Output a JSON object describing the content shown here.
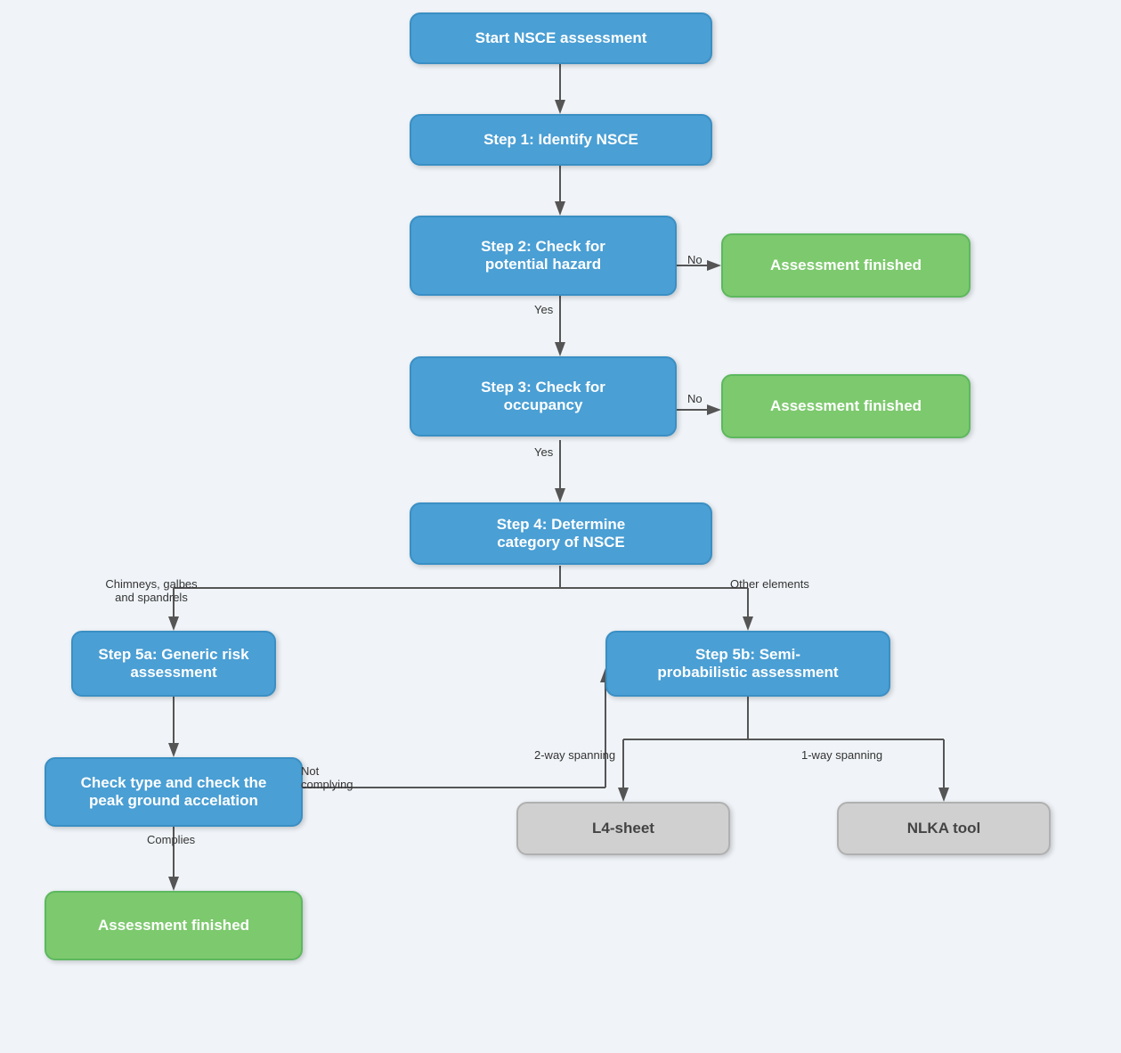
{
  "nodes": {
    "start": {
      "label": "Start NSCE assessment"
    },
    "step1": {
      "label": "Step 1: Identify NSCE"
    },
    "step2": {
      "label": "Step 2: Check for\npotential hazard"
    },
    "step3": {
      "label": "Step 3: Check for\noccupancy"
    },
    "step4": {
      "label": "Step 4: Determine\ncategory of NSCE"
    },
    "step5a": {
      "label": "Step 5a: Generic risk\nassessment"
    },
    "step5b": {
      "label": "Step 5b: Semi-\nprobabilistic assessment"
    },
    "check_peak": {
      "label": "Check type and check the\npeak ground accelation"
    },
    "af1": {
      "label": "Assessment finished"
    },
    "af2": {
      "label": "Assessment finished"
    },
    "af3": {
      "label": "Assessment finished"
    },
    "l4sheet": {
      "label": "L4-sheet"
    },
    "nlka": {
      "label": "NLKA tool"
    }
  },
  "labels": {
    "no1": "No",
    "no2": "No",
    "yes1": "Yes",
    "yes2": "Yes",
    "chimneys": "Chimneys, galbes\nand spandrels",
    "other": "Other elements",
    "complies": "Complies",
    "not_complying": "Not\ncomplying",
    "two_way": "2-way spanning",
    "one_way": "1-way spanning"
  }
}
